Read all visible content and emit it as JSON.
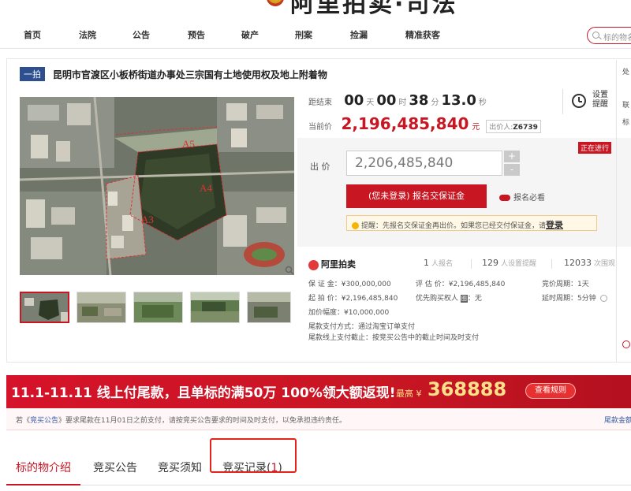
{
  "header": {
    "logo_text": "阿里拍卖·司法"
  },
  "nav": {
    "items": [
      "首页",
      "法院",
      "公告",
      "预告",
      "破产",
      "刑案",
      "捡漏",
      "精准获客"
    ],
    "search_placeholder": "标的物名"
  },
  "lot": {
    "badge": "一拍",
    "title": "昆明市官渡区小板桥街道办事处三宗国有土地使用权及地上附着物",
    "countdown_label": "距结束",
    "countdown": {
      "days": "00",
      "days_unit": "天",
      "hours": "00",
      "hours_unit": "时",
      "minutes": "38",
      "minutes_unit": "分",
      "seconds": "13.0",
      "seconds_unit": "秒"
    },
    "current_price_label": "当前价",
    "current_price": "2,196,485,840",
    "price_unit": "元",
    "bidder_label": "出价人:",
    "bidder_id": "Z6739",
    "reminder_label_1": "设置",
    "reminder_label_2": "提醒",
    "status": "正在进行",
    "bid_label": "出 价",
    "bid_value": "2,206,485,840",
    "signup_button": "(您未登录) 报名交保证金",
    "must_read": "报名必看",
    "tip_text": "提醒：先报名交保证金再出价。如果您已经交付保证金，请",
    "tip_link": "登录",
    "map_labels": [
      "A5",
      "A4",
      "A3"
    ]
  },
  "stats": {
    "brand": "阿里拍卖",
    "signups": "1",
    "signups_label": "人报名",
    "reminders": "129",
    "reminders_label": "人设置提醒",
    "views": "12033",
    "views_label": "次围观"
  },
  "details": {
    "deposit": "保 证 金：¥300,000,000",
    "start_price": "起 拍 价：¥2,196,485,840",
    "increment": "加价幅度：¥10,000,000",
    "appraisal": "评 估 价：¥2,196,485,840",
    "priority": "优先购买权人",
    "priority_tag": "图",
    "priority_value": "：无",
    "period": "竞价周期：1天",
    "delay": "延时周期：5分钟",
    "pay_method": "尾款支付方式：通过淘宝订单支付",
    "pay_deadline": "尾款线上支付截止：按竞买公告中的截止时间及时支付"
  },
  "right_strip": {
    "labels": [
      "处",
      "联",
      "标"
    ]
  },
  "promo": {
    "text": "11.1-11.11 线上付尾款，且单标的满50万 100%领大额返现!",
    "max_label": "最高 ¥",
    "amount": "368888",
    "rules_button": "查看规则"
  },
  "notice": {
    "prefix": "若《",
    "link": "竞买公告",
    "text": "》要求尾款在11月01日之前支付，请按竞买公告要求的时间及时支付，以免承担违约责任。",
    "right": "尾款金额"
  },
  "tabs": [
    {
      "label": "标的物介绍"
    },
    {
      "label": "竞买公告"
    },
    {
      "label": "竞买须知"
    },
    {
      "label": "竞买记录",
      "count": "1"
    }
  ],
  "colors": {
    "accent": "#c81623",
    "badge": "#2d4e8f",
    "highlight_box": "#e4231b"
  }
}
